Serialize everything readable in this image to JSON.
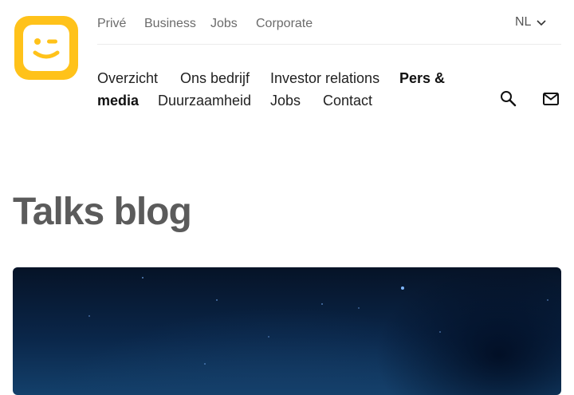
{
  "brand": {
    "logo_icon": "smiley-wink-icon",
    "accent": "#ffc21a"
  },
  "topnav": {
    "items": [
      {
        "label": "Privé"
      },
      {
        "label": "Business"
      },
      {
        "label": "Jobs"
      },
      {
        "label": "Corporate"
      }
    ],
    "language": {
      "label": "NL",
      "icon": "chevron-down-icon"
    }
  },
  "mainnav": {
    "items": [
      {
        "label": "Overzicht"
      },
      {
        "label": "Ons bedrijf"
      },
      {
        "label": "Investor relations"
      },
      {
        "label": "Pers &",
        "active": true
      },
      {
        "label": "media",
        "active": true
      },
      {
        "label": "Duurzaamheid"
      },
      {
        "label": "Jobs"
      },
      {
        "label": "Contact"
      }
    ],
    "search_icon": "search-icon",
    "mail_icon": "mail-icon"
  },
  "page": {
    "title": "Talks blog"
  },
  "hero": {
    "image": "night-sky-stars"
  }
}
